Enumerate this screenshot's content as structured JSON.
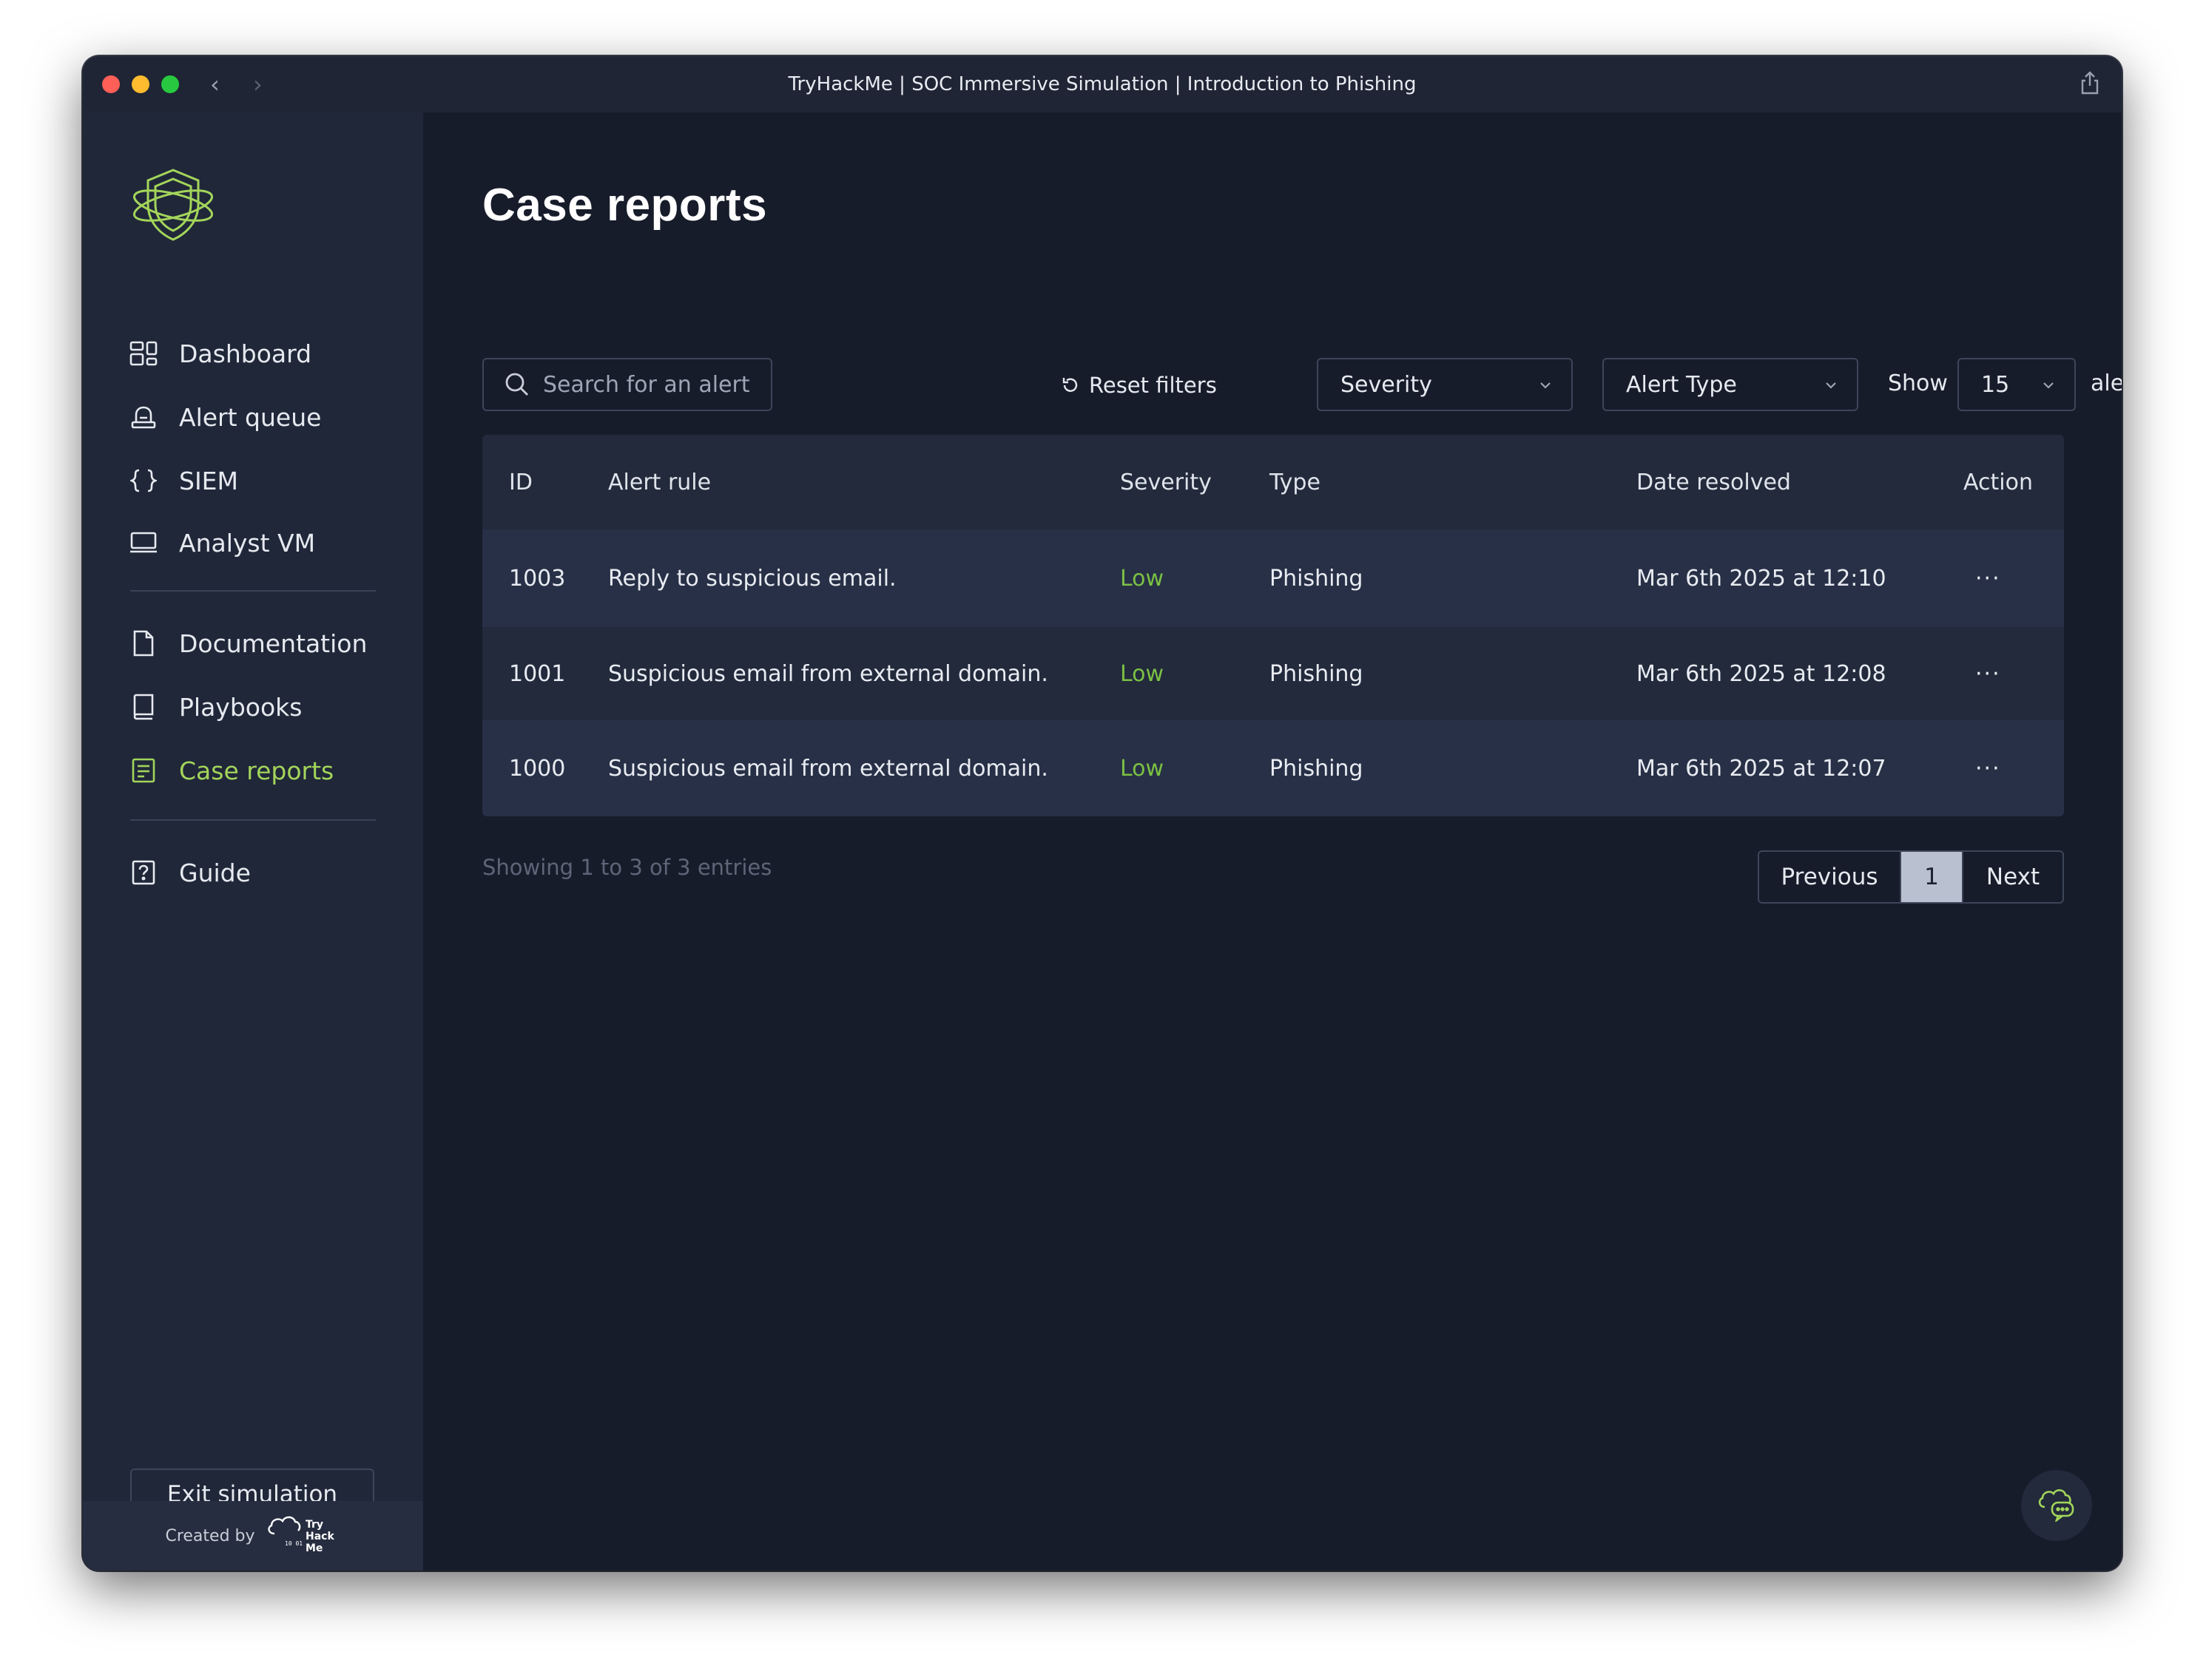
{
  "window": {
    "title": "TryHackMe | SOC Immersive Simulation | Introduction to Phishing"
  },
  "colors": {
    "accent": "#a3d55a",
    "severity_low": "#7bc043",
    "background": "#171c2b",
    "sidebar": "#202739"
  },
  "sidebar": {
    "items": [
      {
        "label": "Dashboard",
        "icon": "dashboard-icon"
      },
      {
        "label": "Alert queue",
        "icon": "alarm-icon"
      },
      {
        "label": "SIEM",
        "icon": "braces-icon"
      },
      {
        "label": "Analyst VM",
        "icon": "monitor-icon"
      },
      {
        "label": "Documentation",
        "icon": "document-icon"
      },
      {
        "label": "Playbooks",
        "icon": "book-icon"
      },
      {
        "label": "Case reports",
        "icon": "report-icon",
        "active": true
      },
      {
        "label": "Guide",
        "icon": "help-icon"
      }
    ],
    "exit_label": "Exit simulation",
    "footer_label": "Created by",
    "brand_logo_text": "Try Hack Me"
  },
  "main": {
    "title": "Case reports",
    "search_placeholder": "Search for an alert",
    "reset_label": "Reset filters",
    "severity_select": "Severity",
    "alert_type_select": "Alert Type",
    "show_label": "Show",
    "show_value": "15",
    "alerts_label": "alerts",
    "table": {
      "headers": [
        "ID",
        "Alert rule",
        "Severity",
        "Type",
        "Date resolved",
        "Action"
      ],
      "rows": [
        {
          "id": "1003",
          "rule": "Reply to suspicious email.",
          "severity": "Low",
          "type": "Phishing",
          "date": "Mar 6th 2025 at 12:10",
          "action": "···"
        },
        {
          "id": "1001",
          "rule": "Suspicious email from external domain.",
          "severity": "Low",
          "type": "Phishing",
          "date": "Mar 6th 2025 at 12:08",
          "action": "···"
        },
        {
          "id": "1000",
          "rule": "Suspicious email from external domain.",
          "severity": "Low",
          "type": "Phishing",
          "date": "Mar 6th 2025 at 12:07",
          "action": "···"
        }
      ]
    },
    "showing_text": "Showing 1 to 3 of 3 entries",
    "pagination": {
      "previous": "Previous",
      "current": "1",
      "next": "Next"
    }
  }
}
